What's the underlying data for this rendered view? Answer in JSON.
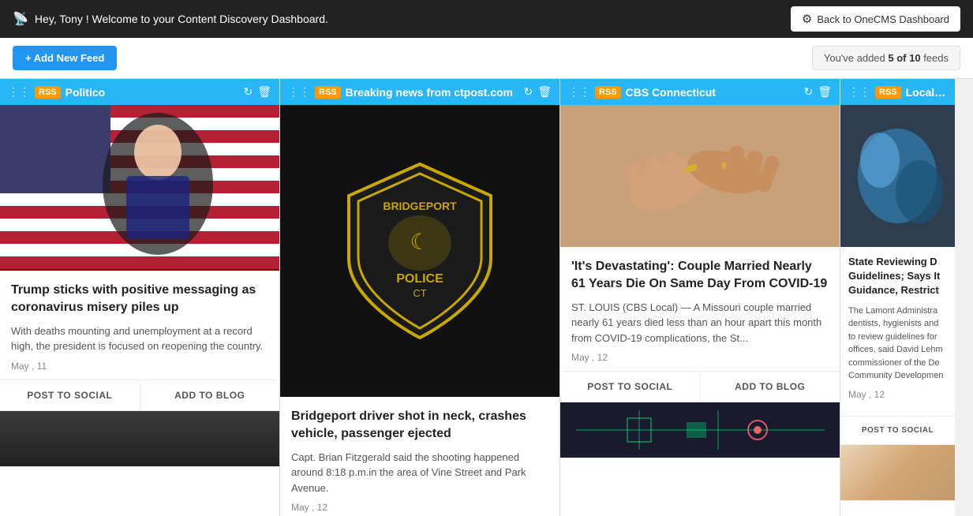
{
  "topBar": {
    "welcome": "Hey, Tony ! Welcome to your Content Discovery Dashboard.",
    "backBtn": "Back to OneCMS Dashboard"
  },
  "toolbar": {
    "addFeedBtn": "+ Add New Feed",
    "feedCounter": "You've added ",
    "feedCountBold": "5 of 10",
    "feedCountSuffix": " feeds"
  },
  "feeds": [
    {
      "id": "politico",
      "title": "Politico",
      "articles": [
        {
          "title": "Trump sticks with positive messaging as coronavirus misery piles up",
          "snippet": "With deaths mounting and unemployment at a record high, the president is focused on reopening the country.",
          "date": "May , 11",
          "actions": [
            "POST TO SOCIAL",
            "ADD TO BLOG"
          ],
          "hasImage": true
        },
        {
          "hasImage": true,
          "title": "",
          "snippet": "",
          "date": "",
          "actions": []
        }
      ]
    },
    {
      "id": "ctpost",
      "title": "Breaking news from ctpost.com",
      "articles": [
        {
          "title": "Bridgeport driver shot in neck, crashes vehicle, passenger ejected",
          "snippet": "Capt. Brian Fitzgerald said the shooting happened around 8:18 p.m.in the area of Vine Street and Park Avenue.",
          "date": "May , 12",
          "actions": [],
          "hasImage": true
        }
      ]
    },
    {
      "id": "cbs-ct",
      "title": "CBS Connecticut",
      "articles": [
        {
          "title": "'It's Devastating': Couple Married Nearly 61 Years Die On Same Day From COVID-19",
          "snippet": "ST. LOUIS (CBS Local) — A Missouri couple married nearly 61 years died less than an hour apart this month from COVID-19 complications, the St...",
          "date": "May , 12",
          "actions": [
            "POST TO SOCIAL",
            "ADD TO BLOG"
          ],
          "hasImage": true
        },
        {
          "hasImage": true,
          "title": "",
          "snippet": "",
          "date": "",
          "actions": []
        }
      ]
    },
    {
      "id": "nbc",
      "title": "Local – NBC Co",
      "articles": [
        {
          "title": "State Reviewing D Guidelines; Says It Guidance, Restrict",
          "snippet": "The Lamont Administra dentists, hygienists and to review guidelines for offices, said David Lehm commissioner of the De Community Developmen",
          "date": "May , 12",
          "actions": [
            "POST TO SOCIAL"
          ],
          "hasImage": true
        },
        {
          "hasImage": true,
          "title": "",
          "snippet": "",
          "date": "",
          "actions": []
        }
      ]
    }
  ]
}
